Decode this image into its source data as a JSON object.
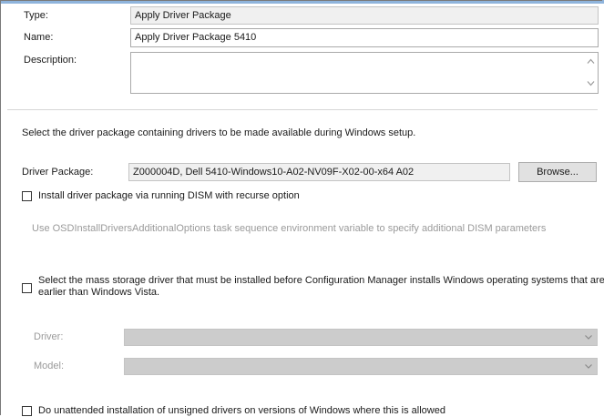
{
  "type": {
    "label": "Type:",
    "value": "Apply Driver Package"
  },
  "name": {
    "label": "Name:",
    "value": "Apply Driver Package 5410"
  },
  "description": {
    "label": "Description:",
    "value": ""
  },
  "instructions": "Select the driver package containing drivers to be made available during Windows setup.",
  "driver_package": {
    "label": "Driver Package:",
    "value": "Z000004D, Dell 5410-Windows10-A02-NV09F-X02-00-x64 A02",
    "browse_label": "Browse..."
  },
  "dism_option": {
    "label": "Install driver package via running DISM with recurse option",
    "checked": false,
    "hint": "Use OSDInstallDriversAdditionalOptions task sequence environment variable to specify additional DISM parameters"
  },
  "mass_storage": {
    "label_line1": "Select the mass storage driver that must be installed before Configuration Manager installs Windows operating systems that are",
    "label_line2": "earlier than Windows Vista.",
    "checked": false,
    "driver_label": "Driver:",
    "model_label": "Model:"
  },
  "unsigned": {
    "label": "Do unattended installation of unsigned drivers on versions of Windows where this is allowed",
    "checked": false
  },
  "colors": {
    "accent_line": "#8fb4dc",
    "disabled_text": "#9a9a9a",
    "disabled_combo": "#cccccc"
  }
}
